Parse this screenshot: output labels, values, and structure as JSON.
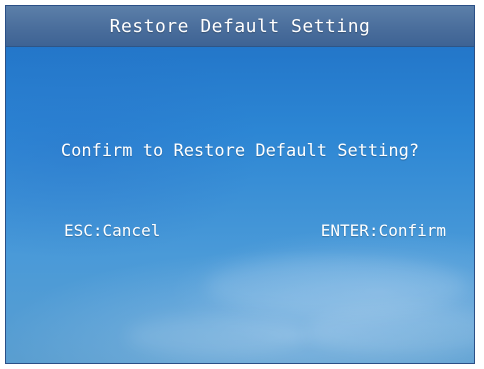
{
  "dialog": {
    "title": "Restore Default Setting",
    "message": "Confirm to Restore Default Setting?",
    "esc_hint": "ESC:Cancel",
    "enter_hint": "ENTER:Confirm"
  },
  "colors": {
    "sky_blue": "#2c86d4",
    "title_bar": "#4a6e9c",
    "text": "#ffffff"
  }
}
